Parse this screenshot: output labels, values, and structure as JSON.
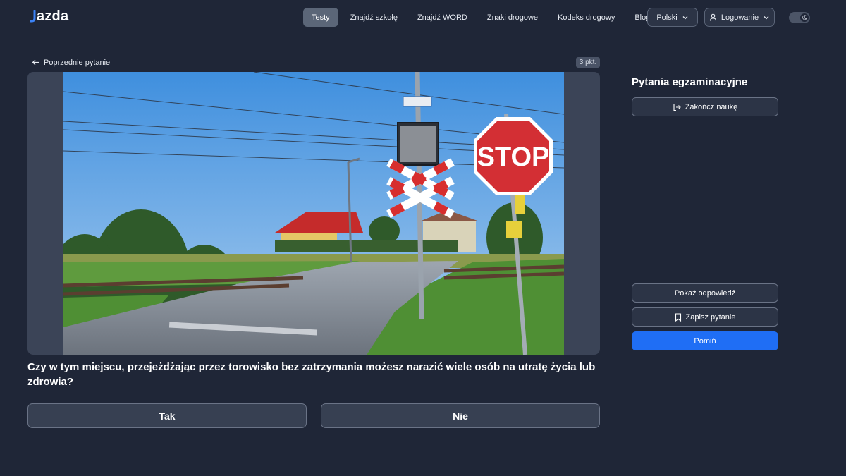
{
  "header": {
    "logo_text": "azda",
    "nav": [
      {
        "label": "Testy",
        "active": true
      },
      {
        "label": "Znajdź szkołę"
      },
      {
        "label": "Znajdź WORD"
      },
      {
        "label": "Znaki drogowe"
      },
      {
        "label": "Kodeks drogowy"
      },
      {
        "label": "Blog"
      }
    ],
    "language": "Polski",
    "login": "Logowanie"
  },
  "question": {
    "prev_label": "Poprzednie pytanie",
    "points": "3 pkt.",
    "sign_text": "STOP",
    "text": "Czy w tym miejscu, przejeżdżając przez torowisko bez zatrzymania możesz narazić wiele osób na utratę życia lub zdrowia?",
    "answers": [
      "Tak",
      "Nie"
    ]
  },
  "sidebar": {
    "title": "Pytania egzaminacyjne",
    "end_label": "Zakończ naukę",
    "show_answer": "Pokaż odpowiedź",
    "save_question": "Zapisz pytanie",
    "skip": "Pomiń"
  },
  "colors": {
    "background": "#1f2637",
    "accent": "#1f6ef5",
    "logo_mark": "#3b82f6"
  }
}
